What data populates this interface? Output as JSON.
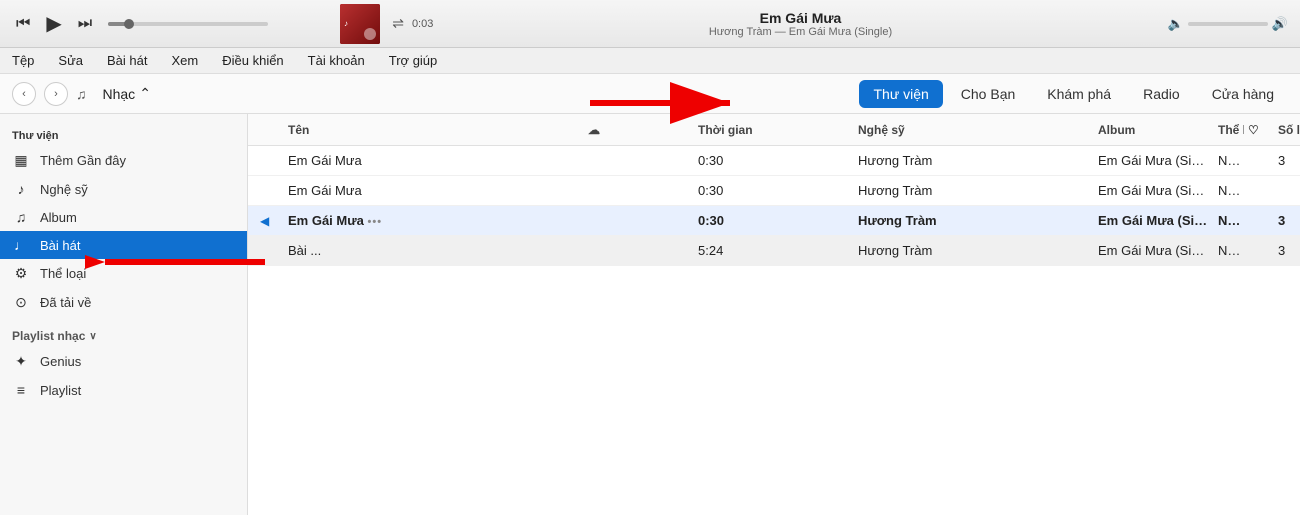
{
  "player": {
    "song_title": "Em Gái Mưa",
    "song_meta": "Hương Tràm — Em Gái Mưa (Single)",
    "time": "0:03",
    "controls": {
      "rewind": "⏮",
      "play": "▶",
      "forward": "⏭"
    }
  },
  "menu": {
    "items": [
      "Tệp",
      "Sửa",
      "Bài hát",
      "Xem",
      "Điều khiển",
      "Tài khoản",
      "Trợ giúp"
    ]
  },
  "nav": {
    "music_label": "Nhạc",
    "tabs": [
      {
        "label": "Thư viện",
        "active": true
      },
      {
        "label": "Cho Bạn",
        "active": false
      },
      {
        "label": "Khám phá",
        "active": false
      },
      {
        "label": "Radio",
        "active": false
      },
      {
        "label": "Cửa hàng",
        "active": false
      }
    ]
  },
  "sidebar": {
    "library_title": "Thư viện",
    "items": [
      {
        "label": "Thêm Gần đây",
        "icon": "▦",
        "active": false
      },
      {
        "label": "Nghệ sỹ",
        "icon": "♪",
        "active": false
      },
      {
        "label": "Album",
        "icon": "♫",
        "active": false
      },
      {
        "label": "Bài hát",
        "icon": "♩",
        "active": true
      },
      {
        "label": "Thể loại",
        "icon": "⚙",
        "active": false
      },
      {
        "label": "Đã tải về",
        "icon": "⊙",
        "active": false
      }
    ],
    "playlist_title": "Playlist nhạc",
    "playlist_items": [
      {
        "label": "Genius",
        "icon": "✦"
      },
      {
        "label": "Playlist",
        "icon": "≡"
      }
    ]
  },
  "track_list": {
    "headers": [
      "",
      "Tên",
      "",
      "",
      "Thời gian",
      "Nghệ sỹ",
      "Album",
      "Thể loại",
      "",
      "Số lần phát"
    ],
    "tracks": [
      {
        "playing": false,
        "name": "Em Gái Mưa",
        "time": "0:30",
        "artist": "Hương Tràm",
        "album": "Em Gái Mưa (Single)",
        "genre": "Nhạc Trẻ",
        "plays": "3"
      },
      {
        "playing": false,
        "name": "Em Gái Mưa",
        "time": "0:30",
        "artist": "Hương Tràm",
        "album": "Em Gái Mưa (Single)",
        "genre": "Nhạc Trẻ",
        "plays": ""
      },
      {
        "playing": true,
        "name": "Em Gái Mưa",
        "time": "0:30",
        "artist": "Hương Tràm",
        "album": "Em Gái Mưa (Single)",
        "genre": "Nhạc Trẻ",
        "plays": "3"
      },
      {
        "playing": false,
        "name": "Bài ...",
        "time": "5:24",
        "artist": "Hương Tràm",
        "album": "Em Gái Mưa (Single)",
        "genre": "Nhạc Trẻ",
        "plays": "3"
      }
    ]
  },
  "arrows": {
    "right_label": "→ Thư viện",
    "left_label": "← Bài hát"
  }
}
